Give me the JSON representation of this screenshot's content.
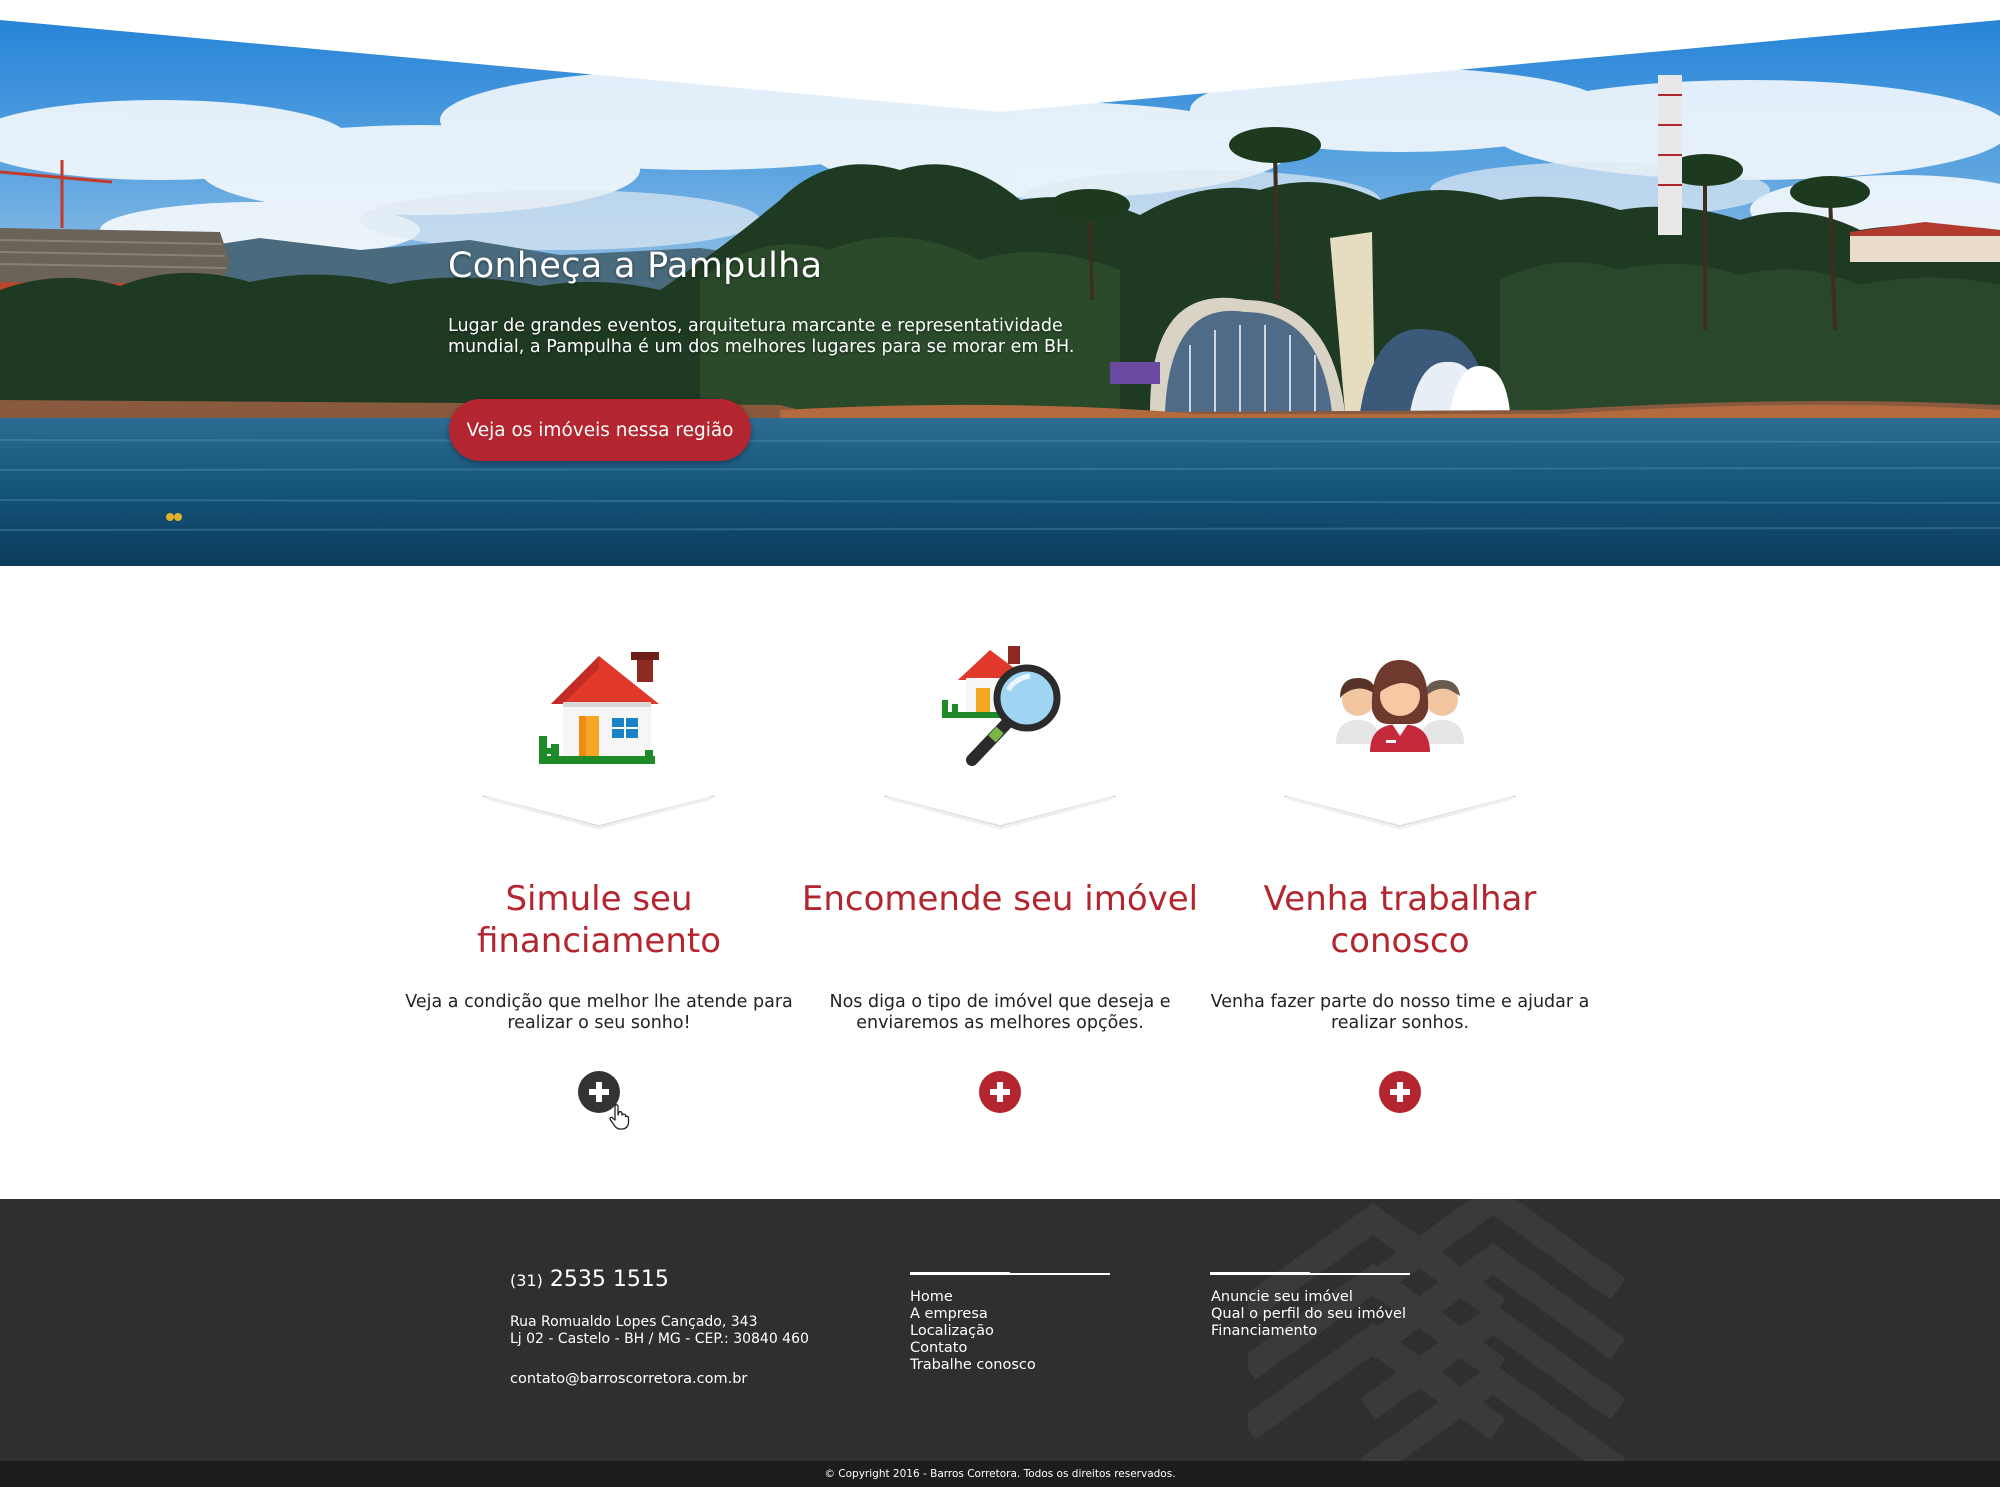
{
  "hero": {
    "title": "Conheça a Pampulha",
    "text": "Lugar de grandes eventos, arquitetura marcante e representatividade mundial, a Pampulha é um dos melhores lugares para se morar em BH.",
    "button_label": "Veja os imóveis nessa região"
  },
  "features": [
    {
      "icon": "house-icon",
      "title": "Simule seu financiamento",
      "text": "Veja a condição que melhor lhe atende para realizar o seu sonho!",
      "action_icon": "plus-icon"
    },
    {
      "icon": "house-search-icon",
      "title": "Encomende seu imóvel",
      "text": "Nos diga o tipo de imóvel que deseja e enviaremos as melhores opções.",
      "action_icon": "plus-icon"
    },
    {
      "icon": "team-icon",
      "title": "Venha trabalhar conosco",
      "text": "Venha fazer parte do nosso time e ajudar a realizar sonhos.",
      "action_icon": "plus-icon"
    }
  ],
  "footer": {
    "phone_ddd": "(31)",
    "phone_number": "2535 1515",
    "address_line1": "Rua Romualdo Lopes Cançado, 343",
    "address_line2": "Lj 02 - Castelo - BH / MG - CEP.: 30840 460",
    "email": "contato@barroscorretora.com.br",
    "nav": [
      "Home",
      "A empresa",
      "Localização",
      "Contato",
      "Trabalhe conosco"
    ],
    "services": [
      "Anuncie seu imóvel",
      "Qual o perfil do seu imóvel",
      "Financiamento"
    ],
    "copyright": "© Copyright 2016 - Barros Corretora. Todos os direitos reservados."
  },
  "colors": {
    "brand_red": "#b3262f",
    "footer_bg": "#2f2f30",
    "copyright_bg": "#1d1d1e"
  }
}
